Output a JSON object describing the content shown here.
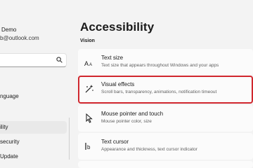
{
  "sidebar": {
    "user_name": "Demo",
    "user_email": "b@outlook.com",
    "search_placeholder": "",
    "items": [
      {
        "label": "nguage"
      },
      {
        "label": "ility"
      },
      {
        "label": "security"
      },
      {
        "label": "Update"
      }
    ],
    "active_index": 1
  },
  "main": {
    "title": "Accessibility",
    "section": "Vision",
    "cards": [
      {
        "icon": "text-size-icon",
        "title": "Text size",
        "desc": "Text size that appears throughout Windows and your apps"
      },
      {
        "icon": "visual-effects-icon",
        "title": "Visual effects",
        "desc": "Scroll bars, transparency, animations, notification timeout"
      },
      {
        "icon": "mouse-pointer-icon",
        "title": "Mouse pointer and touch",
        "desc": "Mouse pointer color, size"
      },
      {
        "icon": "text-cursor-icon",
        "title": "Text cursor",
        "desc": "Appearance and thickness, text cursor indicator"
      }
    ]
  },
  "colors": {
    "highlight_border": "#d0272e",
    "background": "#f3f3f3",
    "card_background": "#fbfbfb"
  }
}
